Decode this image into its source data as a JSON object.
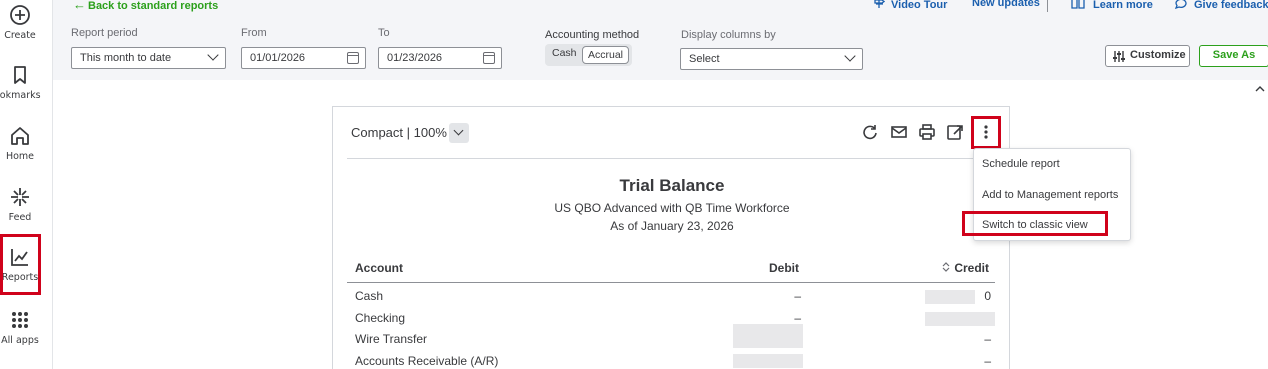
{
  "nav": {
    "items": [
      {
        "label": "Create",
        "icon": "plus-circle-icon"
      },
      {
        "label": "ookmarks",
        "icon": "bookmark-icon"
      },
      {
        "label": "Home",
        "icon": "home-icon"
      },
      {
        "label": "Feed",
        "icon": "sparkle-icon"
      },
      {
        "label": "Reports",
        "icon": "line-chart-icon"
      },
      {
        "label": "All apps",
        "icon": "grid-dots-icon"
      }
    ]
  },
  "header": {
    "back_link": "Back to standard reports",
    "video_tour": "Video Tour",
    "new_updates": "New updates",
    "learn_more": "Learn more",
    "give_feedback": "Give feedback"
  },
  "filters": {
    "report_period_label": "Report period",
    "report_period_value": "This month to date",
    "from_label": "From",
    "from_value": "01/01/2026",
    "to_label": "To",
    "to_value": "01/23/2026",
    "accounting_method_label": "Accounting method",
    "method_cash": "Cash",
    "method_accrual": "Accrual",
    "display_columns_label": "Display columns by",
    "display_columns_value": "Select",
    "customize_label": "Customize",
    "save_as_label": "Save As"
  },
  "report": {
    "view_mode": "Compact",
    "zoom": "100%",
    "title": "Trial Balance",
    "company": "US QBO Advanced with QB Time Workforce",
    "as_of": "As of January 23, 2026",
    "columns": {
      "account": "Account",
      "debit": "Debit",
      "credit": "Credit"
    },
    "rows": [
      {
        "account": "Cash",
        "debit": "–",
        "credit": "0"
      },
      {
        "account": "Checking",
        "debit": "–",
        "credit": ""
      },
      {
        "account": "Wire Transfer",
        "debit": "",
        "credit": "–"
      },
      {
        "account": "Accounts Receivable (A/R)",
        "debit": "",
        "credit": "–"
      }
    ]
  },
  "menu": {
    "items": [
      "Schedule report",
      "Add to Management reports",
      "Switch to classic view"
    ]
  },
  "colors": {
    "accent_green": "#2ca01c",
    "link_blue": "#1b5fae",
    "highlight_red": "#d0021b"
  }
}
